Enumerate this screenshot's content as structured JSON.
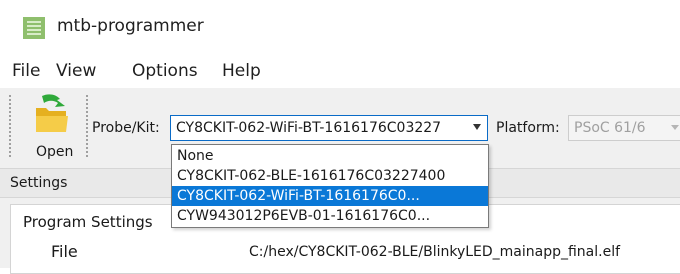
{
  "window": {
    "title": "mtb-programmer",
    "icon": "app-icon"
  },
  "menu": {
    "items": [
      {
        "label": "File"
      },
      {
        "label": "View"
      },
      {
        "label": "Options"
      },
      {
        "label": "Help"
      }
    ]
  },
  "toolbar": {
    "open_label": "Open",
    "open_icon": "folder-open-icon",
    "probe_label": "Probe/Kit:",
    "probe_value": "CY8CKIT-062-WiFi-BT-1616176C03227",
    "platform_label": "Platform:",
    "platform_value": "PSoC 61/6"
  },
  "dropdown": {
    "items": [
      {
        "label": "None",
        "selected": false
      },
      {
        "label": "CY8CKIT-062-BLE-1616176C03227400",
        "selected": false
      },
      {
        "label": "CY8CKIT-062-WiFi-BT-1616176C0...",
        "selected": true
      },
      {
        "label": "CYW943012P6EVB-01-1616176C0...",
        "selected": false
      }
    ],
    "selected_color": "#0a78d7"
  },
  "settings": {
    "header": "Settings",
    "program_settings": "Program Settings",
    "file_label": "File",
    "file_value": "C:/hex/CY8CKIT-062-BLE/BlinkyLED_mainapp_final.elf"
  }
}
